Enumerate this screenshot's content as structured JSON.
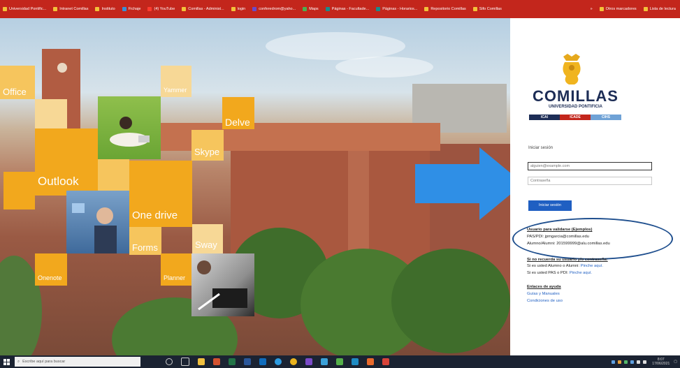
{
  "bookmarks": [
    {
      "label": "Universidad Pontific..."
    },
    {
      "label": "Intranet Comillas"
    },
    {
      "label": "Instituto"
    },
    {
      "label": "Fichaje"
    },
    {
      "label": "(4) YouTube"
    },
    {
      "label": "Comillas - Administ..."
    },
    {
      "label": "login"
    },
    {
      "label": "conferedrom@yaho..."
    },
    {
      "label": "Maps"
    },
    {
      "label": "Páginas - Facultade..."
    },
    {
      "label": "Páginas - Horarios..."
    },
    {
      "label": "Repositorio Comillas"
    },
    {
      "label": "Sifo Comillas"
    }
  ],
  "bookmarks_right": [
    {
      "label": "Otros marcadores"
    },
    {
      "label": "Lista de lectura"
    }
  ],
  "tiles": {
    "office": "Office",
    "outlook": "Outlook",
    "onedrive": "One drive",
    "forms": "Forms",
    "delve": "Delve",
    "skype": "Skype",
    "sway": "Sway",
    "onenote": "Onenote",
    "planner": "Planner",
    "yammer": "Yammer"
  },
  "brand": {
    "name": "COMILLAS",
    "subtitle": "UNIVERSIDAD PONTIFICIA",
    "bar": [
      "ICAI",
      "ICADE",
      "CIHS"
    ],
    "bar_colors": [
      "#1d2d56",
      "#c3261c",
      "#6fa2d6"
    ]
  },
  "login": {
    "heading": "Iniciar sesión",
    "email_placeholder": "alguien@example.com",
    "password_placeholder": "Contraseña",
    "submit_label": "Iniciar sesión"
  },
  "validate": {
    "title": "Usuario para validarse (Ejemplos)",
    "line1": "PAS/PDI: jpmgarcia@comillas.edu",
    "line2": "Alumno/Alumni: 201599999@alu.comillas.edu"
  },
  "forgot": {
    "title": "Si no recuerda su usuario y/o contraseña:",
    "line1_prefix": "Si es usted Alumno o Alumni:",
    "line1_link": "Pinche aquí.",
    "line2_prefix": "Si es usted PAS o PDI:",
    "line2_link": "Pinche aquí."
  },
  "help": {
    "title": "Enlaces de ayuda",
    "guides": "Guías y Manuales",
    "terms": "Condiciones de uso"
  },
  "taskbar": {
    "search_placeholder": "Escribe aquí para buscar",
    "time": "8:07",
    "date": "17/06/2021"
  },
  "colors": {
    "bookmarks_bar": "#c3261c",
    "tile_orange": "#f2a81d",
    "arrow": "#2f8fe6",
    "button": "#1f5fc2",
    "brand_navy": "#1d2d56"
  }
}
